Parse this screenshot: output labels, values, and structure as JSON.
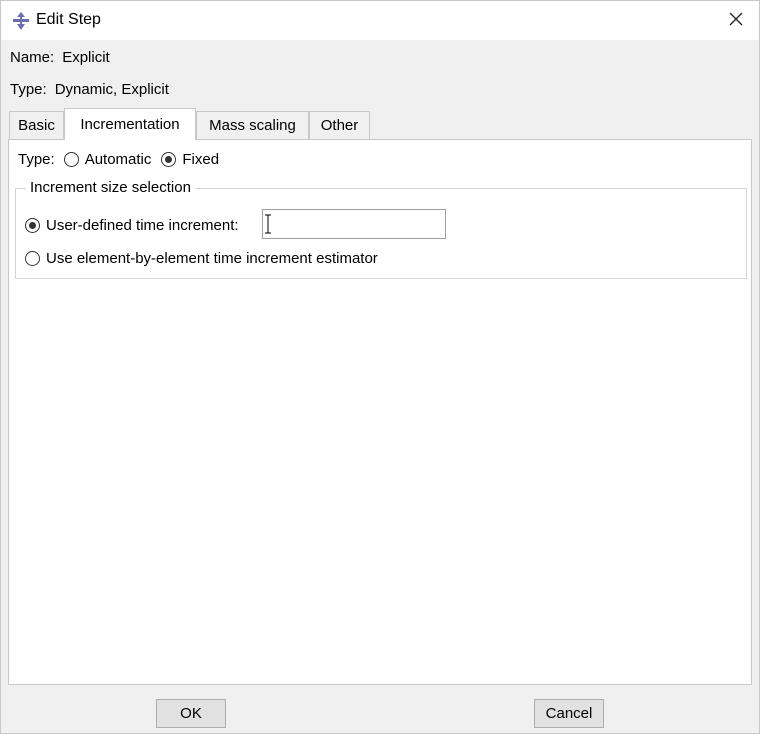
{
  "window": {
    "title": "Edit Step",
    "icon": "step-app-icon",
    "close_icon": "close-icon"
  },
  "info": {
    "name_label": "Name:",
    "name_value": "Explicit",
    "type_label": "Type:",
    "type_value": "Dynamic, Explicit"
  },
  "tabs": [
    {
      "label": "Basic",
      "active": false
    },
    {
      "label": "Incrementation",
      "active": true
    },
    {
      "label": "Mass scaling",
      "active": false
    },
    {
      "label": "Other",
      "active": false
    }
  ],
  "incrementation": {
    "type_label": "Type:",
    "type_options": [
      {
        "label": "Automatic",
        "selected": false
      },
      {
        "label": "Fixed",
        "selected": true
      }
    ],
    "group_title": "Increment size selection",
    "user_defined_label": "User-defined time increment:",
    "user_defined_selected": true,
    "user_defined_value": "",
    "estimator_label": "Use element-by-element time increment estimator",
    "estimator_selected": false
  },
  "buttons": {
    "ok": "OK",
    "cancel": "Cancel"
  }
}
